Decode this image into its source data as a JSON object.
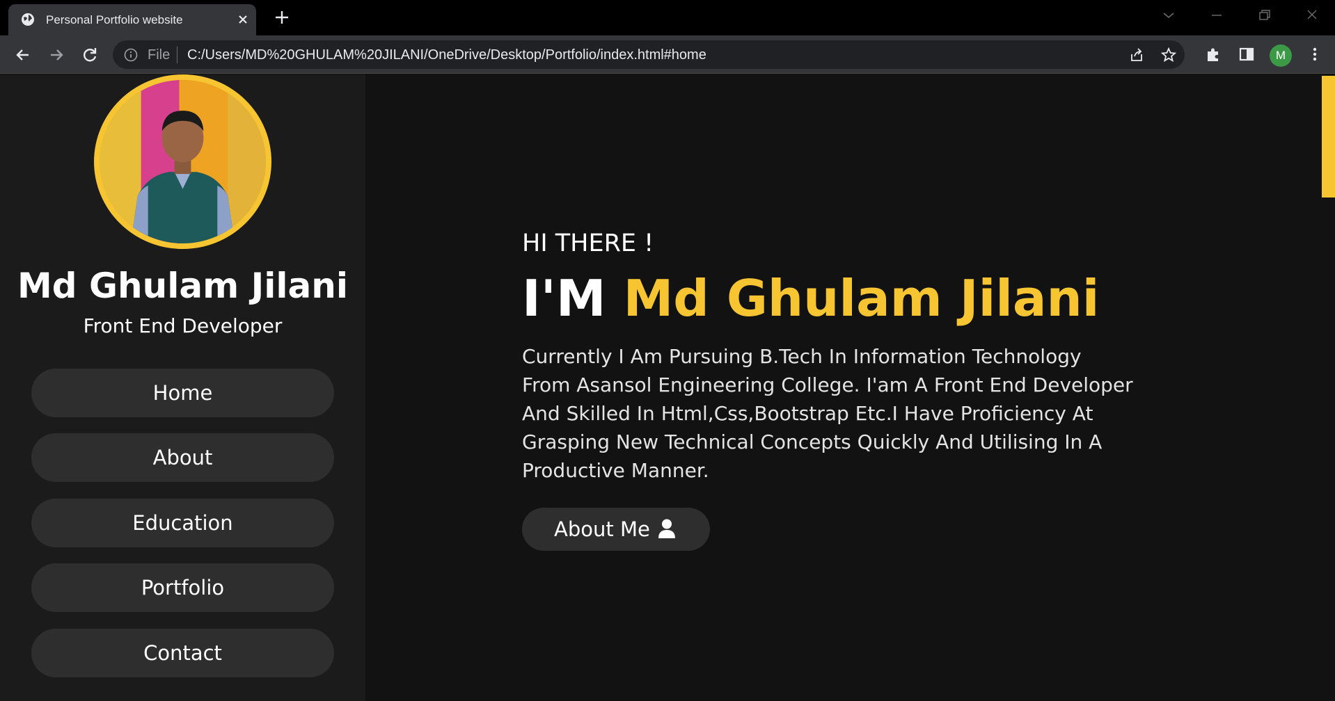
{
  "browser": {
    "tab_title": "Personal Portfolio website",
    "omnibox_scheme_label": "File",
    "url": "C:/Users/MD%20GHULAM%20JILANI/OneDrive/Desktop/Portfolio/index.html#home",
    "profile_initial": "M"
  },
  "sidebar": {
    "name": "Md Ghulam Jilani",
    "role": "Front End Developer",
    "nav": [
      {
        "label": "Home"
      },
      {
        "label": "About"
      },
      {
        "label": "Education"
      },
      {
        "label": "Portfolio"
      },
      {
        "label": "Contact"
      }
    ]
  },
  "hero": {
    "greeting": "HI THERE !",
    "im_prefix": "I'M",
    "name": "Md Ghulam Jilani",
    "bio": "Currently I Am Pursuing B.Tech In Information Technology From Asansol Engineering College. I'am A Front End Developer And Skilled In Html,Css,Bootstrap Etc.I Have Proficiency At Grasping New Technical Concepts Quickly And Utilising In A Productive Manner.",
    "cta_label": "About Me"
  },
  "colors": {
    "accent": "#f7c531",
    "sidebar_bg": "#1b1b1b",
    "main_bg": "#121212",
    "button_bg": "#2e2e2e"
  },
  "icons": [
    "globe-icon",
    "close-icon",
    "plus-icon",
    "back-arrow-icon",
    "forward-arrow-icon",
    "reload-icon",
    "info-icon",
    "share-icon",
    "star-icon",
    "puzzle-icon",
    "side-panel-icon",
    "kebab-menu-icon",
    "user-icon"
  ]
}
